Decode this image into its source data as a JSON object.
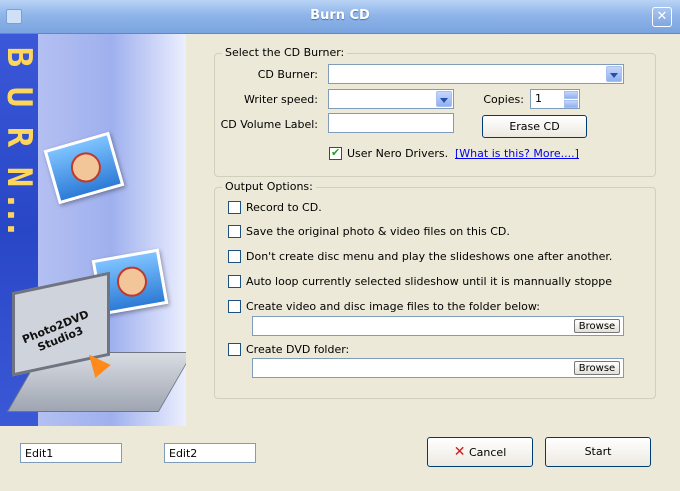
{
  "window": {
    "title": "Burn CD"
  },
  "branding": {
    "side_text": [
      "B",
      "U",
      "R",
      "N",
      ".",
      ".",
      "."
    ],
    "product": "Photo2DVD Studio3"
  },
  "burner_group": {
    "legend": "Select the CD Burner:",
    "cd_burner_label": "CD Burner:",
    "cd_burner_value": "",
    "writer_speed_label": "Writer speed:",
    "writer_speed_value": "",
    "copies_label": "Copies:",
    "copies_value": "1",
    "volume_label_label": "CD Volume Label:",
    "volume_label_value": "",
    "erase_button": "Erase CD",
    "nero_checkbox_label": "User Nero Drivers.",
    "nero_checked": true,
    "help_link": "[What is this?  More....]"
  },
  "output_group": {
    "legend": "Output Options:",
    "options": [
      {
        "label": "Record to CD.",
        "checked": false
      },
      {
        "label": "Save the original photo & video files on this CD.",
        "checked": false
      },
      {
        "label": "Don't create disc menu and play the slideshows one after another.",
        "checked": false
      },
      {
        "label": "Auto loop currently selected slideshow until it is mannually stoppe",
        "checked": false
      },
      {
        "label": "Create video and disc image files to the folder below:",
        "checked": false
      },
      {
        "label": "Create DVD folder:",
        "checked": false
      }
    ],
    "browse_label": "Browse",
    "image_folder_value": "",
    "dvd_folder_value": ""
  },
  "footer": {
    "edit1": "Edit1",
    "edit2": "Edit2",
    "cancel": "Cancel",
    "start": "Start"
  },
  "colors": {
    "accent": "#3A58D8",
    "burn_text": "#FFD65A",
    "title_bar": "#8FB5E9",
    "cancel_x": "#D01818"
  }
}
